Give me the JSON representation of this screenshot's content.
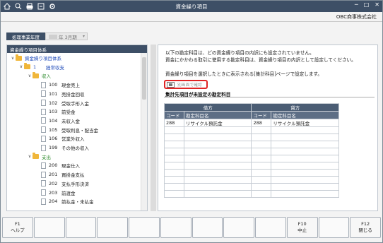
{
  "window": {
    "title": "資金繰り項目",
    "company": "OBC商事株式会社",
    "toolbar_icons": [
      "home-icon",
      "search-icon",
      "print-icon",
      "export-icon",
      "settings-icon"
    ],
    "controls": [
      "─",
      "□",
      "✕"
    ]
  },
  "period": {
    "label": "処理事業年度",
    "value": "年 3月期"
  },
  "tree": {
    "header": "資金繰り項目体系",
    "items": [
      {
        "depth": 0,
        "type": "folder",
        "chevron": "∨",
        "code": "",
        "label": "資金繰り項目体系",
        "color": "blue"
      },
      {
        "depth": 1,
        "type": "folder",
        "chevron": "∨",
        "code": "1",
        "label": "経常収支",
        "color": "blue"
      },
      {
        "depth": 2,
        "type": "folder",
        "chevron": "∨",
        "code": "",
        "label": "収入",
        "color": "green"
      },
      {
        "depth": 3,
        "type": "doc",
        "chevron": "",
        "code": "100",
        "label": "現金売上",
        "color": ""
      },
      {
        "depth": 3,
        "type": "doc",
        "chevron": "",
        "code": "101",
        "label": "売掛金回収",
        "color": ""
      },
      {
        "depth": 3,
        "type": "doc",
        "chevron": "",
        "code": "102",
        "label": "受取手形入金",
        "color": ""
      },
      {
        "depth": 3,
        "type": "doc",
        "chevron": "",
        "code": "103",
        "label": "前受金",
        "color": ""
      },
      {
        "depth": 3,
        "type": "doc",
        "chevron": "",
        "code": "104",
        "label": "未収入金",
        "color": ""
      },
      {
        "depth": 3,
        "type": "doc",
        "chevron": "",
        "code": "105",
        "label": "受取利息・配当金",
        "color": ""
      },
      {
        "depth": 3,
        "type": "doc",
        "chevron": "",
        "code": "106",
        "label": "営業外収入",
        "color": ""
      },
      {
        "depth": 3,
        "type": "doc",
        "chevron": "",
        "code": "199",
        "label": "その他の収入",
        "color": ""
      },
      {
        "depth": 2,
        "type": "folder",
        "chevron": "∨",
        "code": "",
        "label": "支出",
        "color": "green"
      },
      {
        "depth": 3,
        "type": "doc",
        "chevron": "",
        "code": "200",
        "label": "現金仕入",
        "color": ""
      },
      {
        "depth": 3,
        "type": "doc",
        "chevron": "",
        "code": "201",
        "label": "買掛金支払",
        "color": ""
      },
      {
        "depth": 3,
        "type": "doc",
        "chevron": "",
        "code": "202",
        "label": "支払手形決済",
        "color": ""
      },
      {
        "depth": 3,
        "type": "doc",
        "chevron": "",
        "code": "203",
        "label": "前渡金",
        "color": ""
      },
      {
        "depth": 3,
        "type": "doc",
        "chevron": "",
        "code": "204",
        "label": "前払金・未払金",
        "color": ""
      }
    ]
  },
  "right": {
    "notice_lines": [
      "以下の勘定科目は、どの資金繰り項目の内訳にも設定されていません。",
      "資金にかかわる取引に使用する勘定科目は、資金繰り項目の内訳として設定してください。",
      "",
      "資金繰り項目を選択したときに表示される[集計科目]ページで設定します。"
    ],
    "separate_button": "別画面で確認",
    "section_title": "集計先項目が未設定の勘定科目",
    "debit_header": "借方",
    "credit_header": "貸方",
    "col_code": "コード",
    "col_name": "勘定科目名",
    "rows": [
      {
        "debit_code": "288",
        "debit_name": "リサイクル預託金",
        "credit_code": "288",
        "credit_name": "リサイクル預託金"
      }
    ],
    "empty_rows": 10
  },
  "fkeys": [
    {
      "key": "F1",
      "label": "ヘルプ"
    },
    {
      "key": "",
      "label": ""
    },
    {
      "key": "",
      "label": ""
    },
    {
      "key": "",
      "label": ""
    },
    {
      "key": "",
      "label": ""
    },
    {
      "key": "",
      "label": ""
    },
    {
      "key": "",
      "label": ""
    },
    {
      "key": "",
      "label": ""
    },
    {
      "key": "",
      "label": ""
    },
    {
      "key": "F10",
      "label": "中止"
    },
    {
      "key": "",
      "label": ""
    },
    {
      "key": "F12",
      "label": "閉じる"
    }
  ],
  "colors": {
    "titlebar": "#3d4f66",
    "highlight_border": "#e02424",
    "folder": "#f0b63a",
    "link_blue": "#1a47b8",
    "group_green": "#2a8a2a"
  }
}
